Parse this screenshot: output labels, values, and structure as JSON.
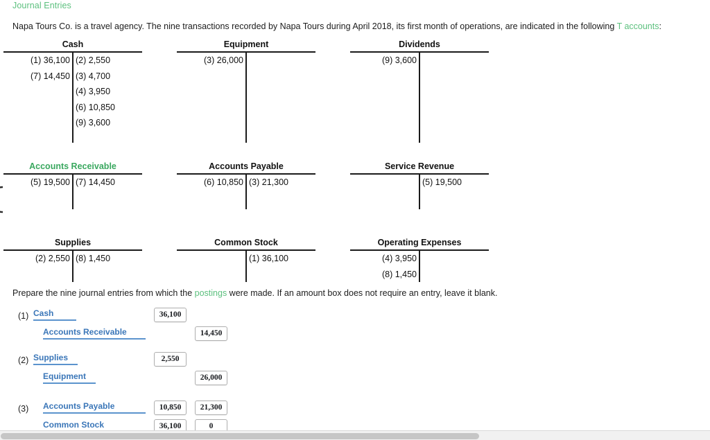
{
  "header": {
    "section_title": "Journal Entries",
    "intro_before": "Napa Tours Co. is a travel agency. The nine transactions recorded by Napa Tours during April 2018, its first month of operations, are indicated in the following ",
    "intro_link": "T accounts",
    "intro_after": ":"
  },
  "prompt": {
    "before": "Prepare the nine journal entries from which the ",
    "link": "postings",
    "after": " were made. If an amount box does not require an entry, leave it blank."
  },
  "t_accounts": [
    {
      "name": "Cash",
      "highlight": false,
      "rows": [
        {
          "debit": "(1) 36,100",
          "credit": "(2) 2,550"
        },
        {
          "debit": "(7) 14,450",
          "credit": "(3) 4,700"
        },
        {
          "debit": "",
          "credit": "(4) 3,950"
        },
        {
          "debit": "",
          "credit": "(6) 10,850"
        },
        {
          "debit": "",
          "credit": "(9) 3,600"
        }
      ]
    },
    {
      "name": "Equipment",
      "highlight": false,
      "rows": [
        {
          "debit": "(3) 26,000",
          "credit": ""
        }
      ]
    },
    {
      "name": "Dividends",
      "highlight": false,
      "rows": [
        {
          "debit": "(9) 3,600",
          "credit": ""
        }
      ]
    },
    {
      "name": "Accounts Receivable",
      "highlight": true,
      "rows": [
        {
          "debit": "(5) 19,500",
          "credit": "(7) 14,450"
        }
      ]
    },
    {
      "name": "Accounts Payable",
      "highlight": false,
      "rows": [
        {
          "debit": "(6) 10,850",
          "credit": "(3) 21,300"
        }
      ]
    },
    {
      "name": "Service Revenue",
      "highlight": false,
      "rows": [
        {
          "debit": "",
          "credit": "(5) 19,500"
        }
      ]
    },
    {
      "name": "Supplies",
      "highlight": false,
      "rows": [
        {
          "debit": "(2) 2,550",
          "credit": "(8) 1,450"
        }
      ]
    },
    {
      "name": "Common Stock",
      "highlight": false,
      "rows": [
        {
          "debit": "",
          "credit": "(1) 36,100"
        }
      ]
    },
    {
      "name": "Operating Expenses",
      "highlight": false,
      "rows": [
        {
          "debit": "(4) 3,950",
          "credit": ""
        },
        {
          "debit": "(8) 1,450",
          "credit": ""
        }
      ]
    }
  ],
  "journal_entries": [
    {
      "number": "(1)",
      "lines": [
        {
          "account": "Cash",
          "indent": 0,
          "debit": "36,100",
          "credit": null
        },
        {
          "account": "Accounts Receivable",
          "indent": 1,
          "debit": null,
          "credit": "14,450"
        }
      ]
    },
    {
      "number": "(2)",
      "lines": [
        {
          "account": "Supplies",
          "indent": 0,
          "debit": "2,550",
          "credit": null
        },
        {
          "account": "Equipment",
          "indent": 1,
          "debit": null,
          "credit": "26,000"
        }
      ]
    },
    {
      "number": "(3)",
      "lines": [
        {
          "account": "Accounts Payable",
          "indent": 1,
          "debit": "10,850",
          "credit": "21,300"
        },
        {
          "account": "Common Stock",
          "indent": 1,
          "debit": "36,100",
          "credit": "0"
        }
      ]
    }
  ],
  "colors": {
    "green_link": "#5cc07e",
    "green_title": "#3aa85f",
    "blue_account": "#3a76b8",
    "rule_black": "#1a1a1a"
  }
}
